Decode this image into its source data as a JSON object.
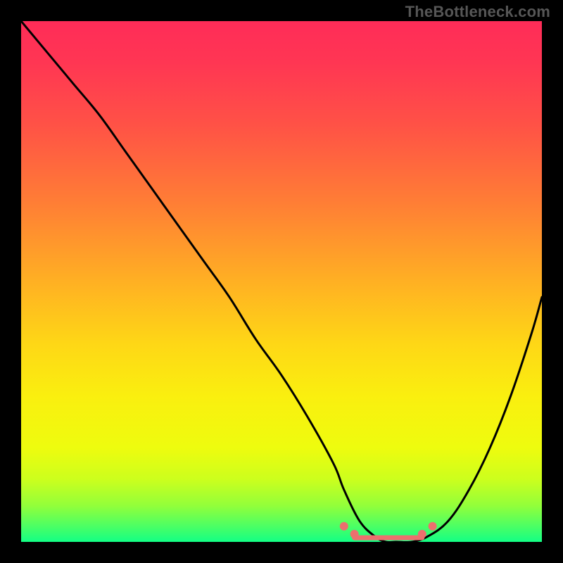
{
  "watermark": "TheBottleneck.com",
  "colors": {
    "frame": "#000000",
    "curve": "#000000",
    "marker": "#ED6F6E",
    "gradient_stops": [
      {
        "offset": 0.0,
        "color": "#FF2C58"
      },
      {
        "offset": 0.08,
        "color": "#FF3653"
      },
      {
        "offset": 0.2,
        "color": "#FF5246"
      },
      {
        "offset": 0.35,
        "color": "#FF7E35"
      },
      {
        "offset": 0.5,
        "color": "#FFB023"
      },
      {
        "offset": 0.62,
        "color": "#FED716"
      },
      {
        "offset": 0.72,
        "color": "#FAEF0F"
      },
      {
        "offset": 0.82,
        "color": "#EEFC0E"
      },
      {
        "offset": 0.88,
        "color": "#CCFF1D"
      },
      {
        "offset": 0.93,
        "color": "#93FF3A"
      },
      {
        "offset": 0.97,
        "color": "#4BFF64"
      },
      {
        "offset": 1.0,
        "color": "#13FF85"
      }
    ]
  },
  "chart_data": {
    "type": "line",
    "title": "",
    "xlabel": "",
    "ylabel": "",
    "xlim": [
      0,
      100
    ],
    "ylim": [
      0,
      100
    ],
    "grid": false,
    "annotations": [
      "TheBottleneck.com"
    ],
    "series": [
      {
        "name": "bottleneck-curve",
        "x": [
          0,
          5,
          10,
          15,
          20,
          25,
          30,
          35,
          40,
          45,
          50,
          55,
          60,
          62,
          65,
          68,
          70,
          72,
          75,
          78,
          82,
          86,
          90,
          94,
          98,
          100
        ],
        "y": [
          100,
          94,
          88,
          82,
          75,
          68,
          61,
          54,
          47,
          39,
          32,
          24,
          15,
          10,
          4,
          1,
          0,
          0,
          0,
          1,
          4,
          10,
          18,
          28,
          40,
          47
        ]
      }
    ],
    "markers": [
      {
        "name": "flat-region-start-outer",
        "x": 62,
        "y": 3.0
      },
      {
        "name": "flat-region-start-inner",
        "x": 64,
        "y": 1.5
      },
      {
        "name": "flat-region-end-inner",
        "x": 77,
        "y": 1.5
      },
      {
        "name": "flat-region-end-outer",
        "x": 79,
        "y": 3.0
      }
    ],
    "flat_segment": {
      "x_start": 64,
      "x_end": 77,
      "y": 0.8
    }
  }
}
